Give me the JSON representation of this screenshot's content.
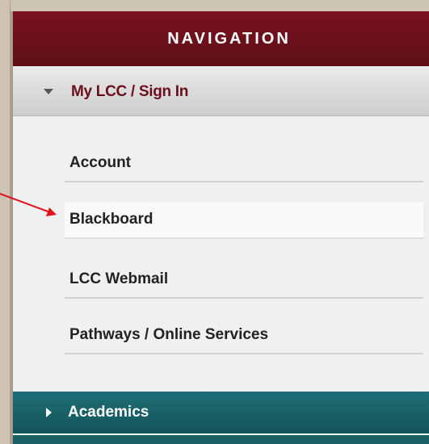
{
  "navigation": {
    "title": "NAVIGATION"
  },
  "section": {
    "label": "My LCC / Sign In",
    "expanded": true
  },
  "links": [
    {
      "label": "Account"
    },
    {
      "label": "Blackboard",
      "highlighted": true
    },
    {
      "label": "LCC Webmail"
    },
    {
      "label": "Pathways / Online Services"
    }
  ],
  "academics": {
    "label": "Academics",
    "expanded": false
  },
  "annotation": {
    "arrow_color": "#e0141e",
    "points_to": "Blackboard"
  },
  "colors": {
    "header": "#6b1020",
    "section_text": "#6b0f1c",
    "academics": "#1a6168",
    "frame": "#cdc3b2"
  }
}
